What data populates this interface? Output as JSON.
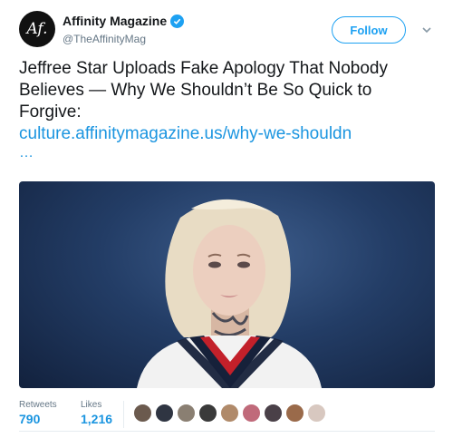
{
  "account": {
    "avatar_text": "Af.",
    "display_name": "Affinity Magazine",
    "handle": "@TheAffinityMag",
    "follow_label": "Follow"
  },
  "tweet": {
    "text": "Jeffree Star Uploads Fake Apology That Nobody Believes — Why We Shouldn’t Be So Quick to Forgive:",
    "link": "culture.affinitymagazine.us/why-we-shouldn",
    "link_ellipsis": "…"
  },
  "stats": {
    "retweets_label": "Retweets",
    "retweets_value": "790",
    "likes_label": "Likes",
    "likes_value": "1,216"
  },
  "colors": {
    "accent": "#1da1f2",
    "link": "#1b95e0",
    "secondary_text": "#657786"
  },
  "icons": [
    "verified-badge-icon",
    "chevron-down-icon"
  ]
}
